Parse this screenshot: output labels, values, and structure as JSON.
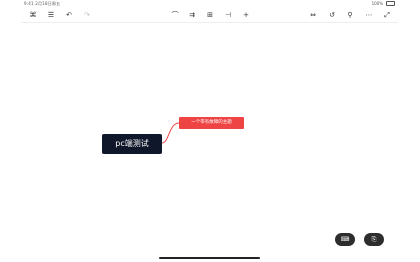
{
  "status": {
    "left_text": "9:41  2月18日周五",
    "right_text": "100%"
  },
  "toolbar": {
    "left": [
      {
        "icon": "layout-icon",
        "glyph": "⌘"
      },
      {
        "icon": "outline-list-icon",
        "glyph": "☰"
      },
      {
        "icon": "undo-icon",
        "glyph": "↶"
      },
      {
        "icon": "redo-icon",
        "glyph": "↷"
      }
    ],
    "center": [
      {
        "icon": "brush-icon",
        "glyph": "⌒"
      },
      {
        "icon": "insert-child-icon",
        "glyph": "⇉"
      },
      {
        "icon": "insert-sibling-icon",
        "glyph": "⊞"
      },
      {
        "icon": "insert-parent-icon",
        "glyph": "⊣"
      },
      {
        "icon": "add-icon",
        "glyph": "+"
      }
    ],
    "right": [
      {
        "icon": "fit-width-icon",
        "glyph": "⇔"
      },
      {
        "icon": "history-icon",
        "glyph": "↺"
      },
      {
        "icon": "pin-icon",
        "glyph": "⚲"
      },
      {
        "icon": "more-icon",
        "glyph": "⋯"
      },
      {
        "icon": "expand-icon",
        "glyph": "⤢"
      }
    ]
  },
  "mindmap": {
    "root_label": "pc端测试",
    "child_label": "一个带有故障的主题",
    "root_color": "#0f172a",
    "child_color": "#ef4444",
    "line_color": "#ef4444"
  },
  "fabs": [
    {
      "icon": "keyboard-icon",
      "glyph": "⌨"
    },
    {
      "icon": "share-icon",
      "glyph": "⎘"
    }
  ]
}
